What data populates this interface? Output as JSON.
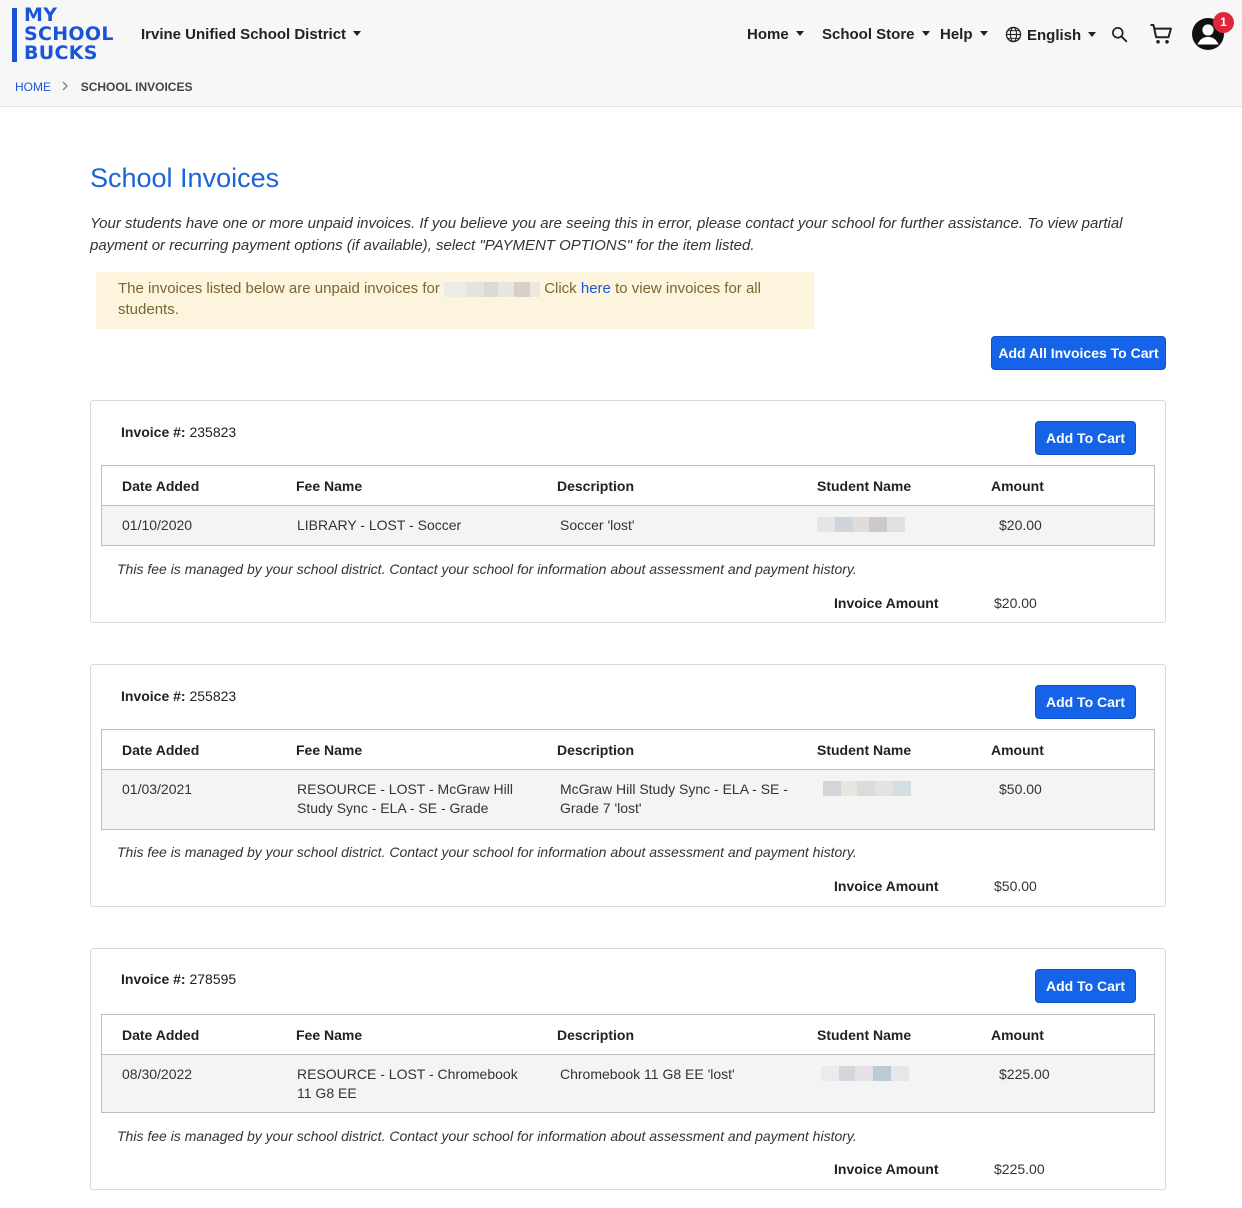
{
  "header": {
    "logo_lines": [
      "MY",
      "SCHOOL",
      "BUCKS"
    ],
    "district": "Irvine Unified School District",
    "nav": [
      "Home",
      "School Store",
      "Help"
    ],
    "language": "English",
    "notification_count": "1",
    "icons": [
      "globe-icon",
      "search-icon",
      "cart-icon",
      "account-icon"
    ]
  },
  "breadcrumb": {
    "home": "HOME",
    "current": "SCHOOL INVOICES"
  },
  "page": {
    "title": "School Invoices",
    "intro": "Your students have one or more unpaid invoices. If you believe you are seeing this in error, please contact your school for further assistance. To view partial payment or recurring payment options (if available), select \"PAYMENT OPTIONS\" for the item listed.",
    "notice_before": "The invoices listed below are unpaid invoices for",
    "notice_click": "Click",
    "notice_link": "here",
    "notice_after": "to view invoices for all students.",
    "add_all_button": "Add All Invoices To Cart"
  },
  "columns": [
    "Date Added",
    "Fee Name",
    "Description",
    "Student Name",
    "Amount"
  ],
  "invoice_label": "Invoice #:",
  "add_to_cart_label": "Add To Cart",
  "note": "This fee is managed by your school district. Contact your school for information about assessment and payment history.",
  "invoice_amount_label": "Invoice Amount",
  "invoices": [
    {
      "number": "235823",
      "date": "01/10/2020",
      "fee_name": "LIBRARY - LOST - Soccer",
      "description": "Soccer 'lost'",
      "amount": "$20.00",
      "invoice_amount": "$20.00"
    },
    {
      "number": "255823",
      "date": "01/03/2021",
      "fee_name": "RESOURCE - LOST - McGraw Hill Study Sync - ELA - SE - Grade",
      "description": "McGraw Hill Study Sync - ELA - SE - Grade 7 'lost'",
      "amount": "$50.00",
      "invoice_amount": "$50.00"
    },
    {
      "number": "278595",
      "date": "08/30/2022",
      "fee_name": "RESOURCE - LOST - Chromebook 11 G8 EE",
      "description": "Chromebook 11 G8 EE 'lost'",
      "amount": "$225.00",
      "invoice_amount": "$225.00"
    }
  ],
  "colors": {
    "brand_blue": "#1a55d8",
    "button_blue": "#1463e8",
    "notice_bg": "#fcf4dd",
    "badge_red": "#e0263b"
  }
}
